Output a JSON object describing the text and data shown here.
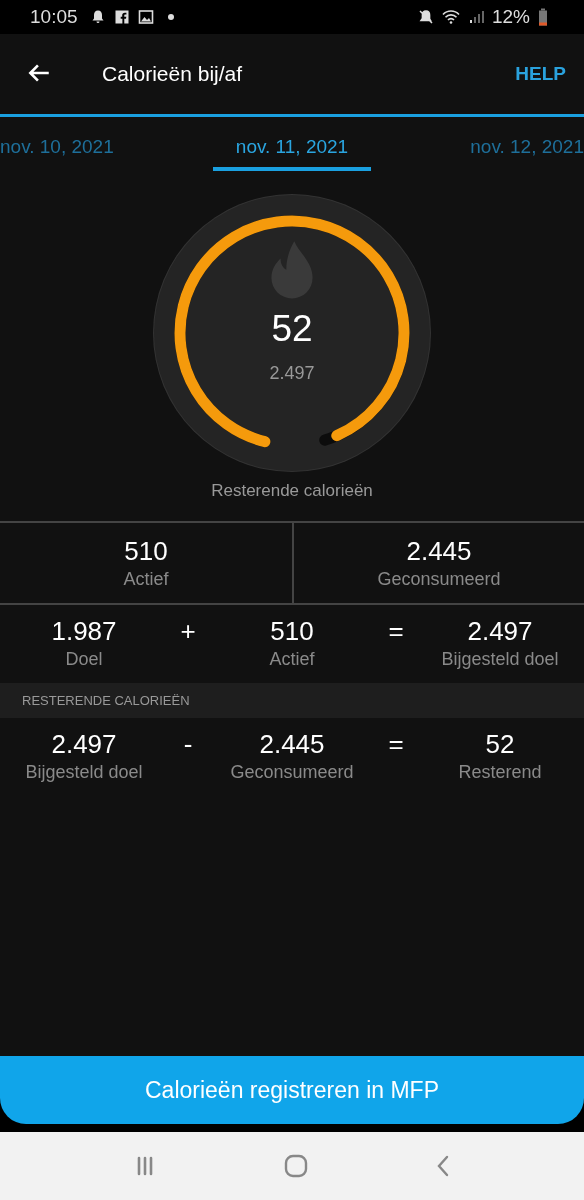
{
  "status_bar": {
    "time": "10:05",
    "battery": "12%"
  },
  "app_bar": {
    "title": "Calorieën bij/af",
    "help": "HELP"
  },
  "date_tabs": [
    {
      "label": "nov. 10, 2021",
      "selected": false
    },
    {
      "label": "nov. 11, 2021",
      "selected": true
    },
    {
      "label": "nov. 12, 2021",
      "selected": false
    }
  ],
  "gauge": {
    "value": "52",
    "total": "2.497",
    "level": 0.98,
    "caption": "Resterende calorieën"
  },
  "summary": [
    {
      "value": "510",
      "label": "Actief"
    },
    {
      "value": "2.445",
      "label": "Geconsumeerd"
    }
  ],
  "goal_equation": {
    "terms": [
      {
        "value": "1.987",
        "label": "Doel"
      },
      {
        "value": "510",
        "label": "Actief"
      },
      {
        "value": "2.497",
        "label": "Bijgesteld doel"
      }
    ],
    "operators": [
      "+",
      "="
    ]
  },
  "remaining": {
    "header": "RESTERENDE CALORIEËN",
    "terms": [
      {
        "value": "2.497",
        "label": "Bijgesteld doel"
      },
      {
        "value": "2.445",
        "label": "Geconsumeerd"
      },
      {
        "value": "52",
        "label": "Resterend"
      }
    ],
    "operators": [
      "-",
      "="
    ]
  },
  "button": "Calorieën registreren in MFP"
}
